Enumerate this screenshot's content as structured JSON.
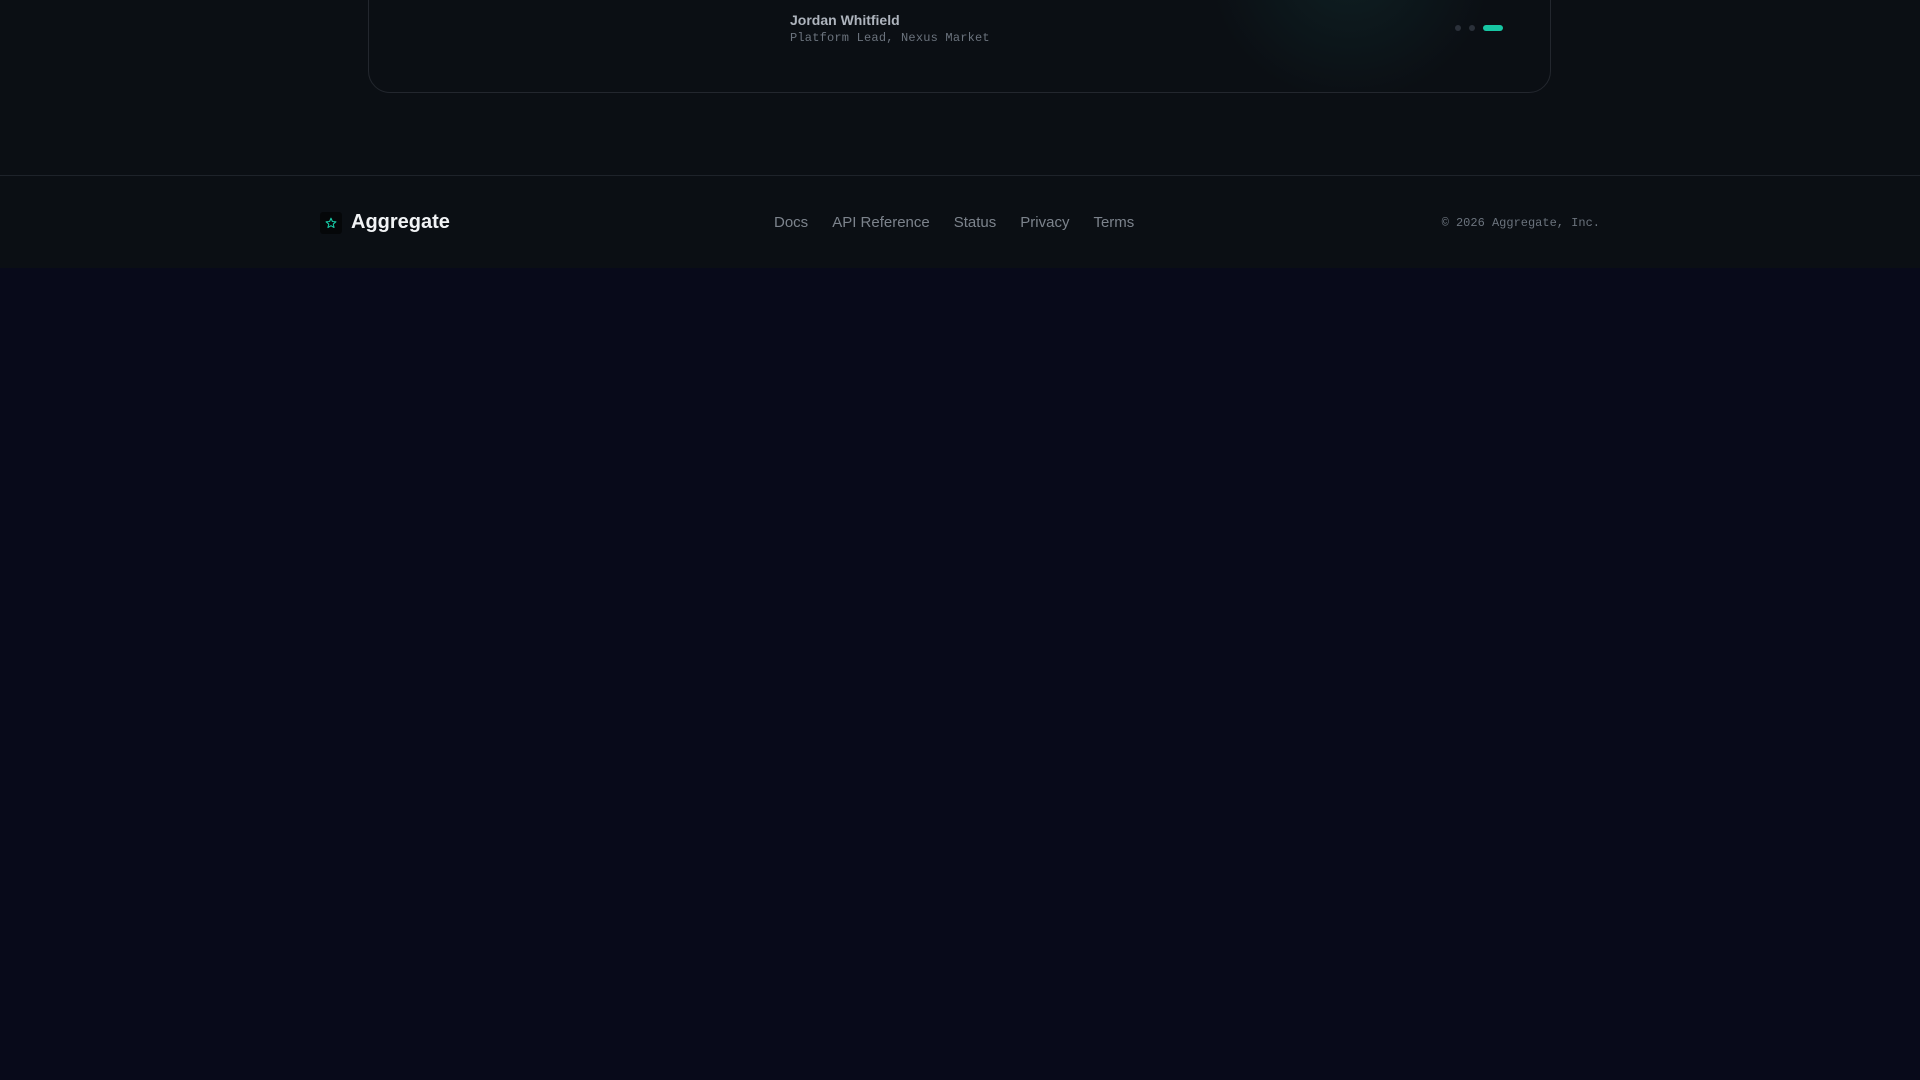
{
  "testimonial": {
    "author_name": "Jordan Whitfield",
    "author_role": "Platform Lead, Nexus Market",
    "carousel": {
      "total": 3,
      "active_index": 3
    }
  },
  "footer": {
    "brand": {
      "name": "Aggregate",
      "icon": "star-icon"
    },
    "links": [
      {
        "label": "Docs"
      },
      {
        "label": "API Reference"
      },
      {
        "label": "Status"
      },
      {
        "label": "Privacy"
      },
      {
        "label": "Terms"
      }
    ],
    "copyright": "© 2026 Aggregate, Inc."
  },
  "colors": {
    "accent": "#17c6a3",
    "background": "#080a1a",
    "surface": "#0b0f14"
  }
}
